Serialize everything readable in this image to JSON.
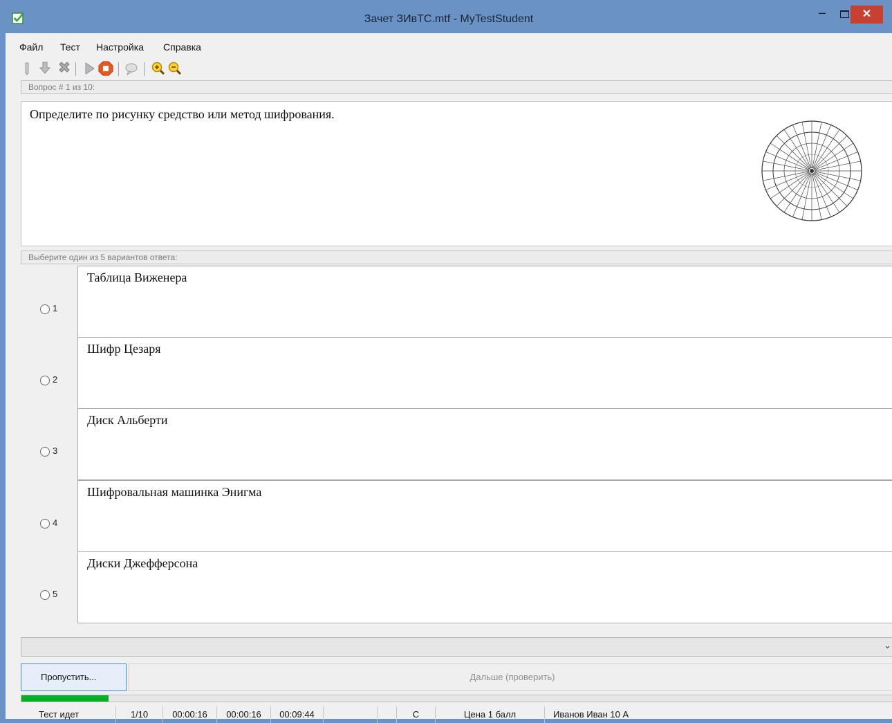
{
  "window": {
    "title": "Зачет ЗИвТС.mtf - MyTestStudent",
    "minimize_glyph": "–",
    "close_glyph": "✕"
  },
  "menu": {
    "items": [
      "Файл",
      "Тест",
      "Настройка",
      "Справка"
    ]
  },
  "toolbar": {
    "icons": [
      "open-icon",
      "save-icon",
      "delete-icon",
      "play-icon",
      "stop-icon",
      "chat-icon",
      "zoom-in-icon",
      "zoom-out-icon"
    ]
  },
  "question": {
    "header": "Вопрос # 1 из 10:",
    "text": "Определите по рисунку средство или метод шифрования."
  },
  "answers": {
    "header": "Выберите один из 5 вариантов ответа:",
    "options": [
      {
        "number": "1",
        "text": "Таблица Виженера"
      },
      {
        "number": "2",
        "text": "Шифр Цезаря"
      },
      {
        "number": "3",
        "text": "Диск Альберти"
      },
      {
        "number": "4",
        "text": "Шифровальная машинка Энигма"
      },
      {
        "number": "5",
        "text": "Диски Джефферсона"
      }
    ]
  },
  "buttons": {
    "skip": "Пропустить...",
    "next": "Дальше (проверить)"
  },
  "progress": {
    "fraction": 0.1
  },
  "status": {
    "state": "Тест идет",
    "question_counter": "1/10",
    "time1": "00:00:16",
    "time2": "00:00:16",
    "time3": "00:09:44",
    "blank1": "",
    "blank2": "",
    "mode": "С",
    "price": "Цена 1 балл",
    "student": "Иванов Иван 10 А"
  },
  "colors": {
    "title_bar": "#6a92c4",
    "close_button": "#c84031",
    "progress_fill": "#06b025",
    "stop_icon": "#e8571c",
    "zoom_icon": "#e9b100"
  }
}
